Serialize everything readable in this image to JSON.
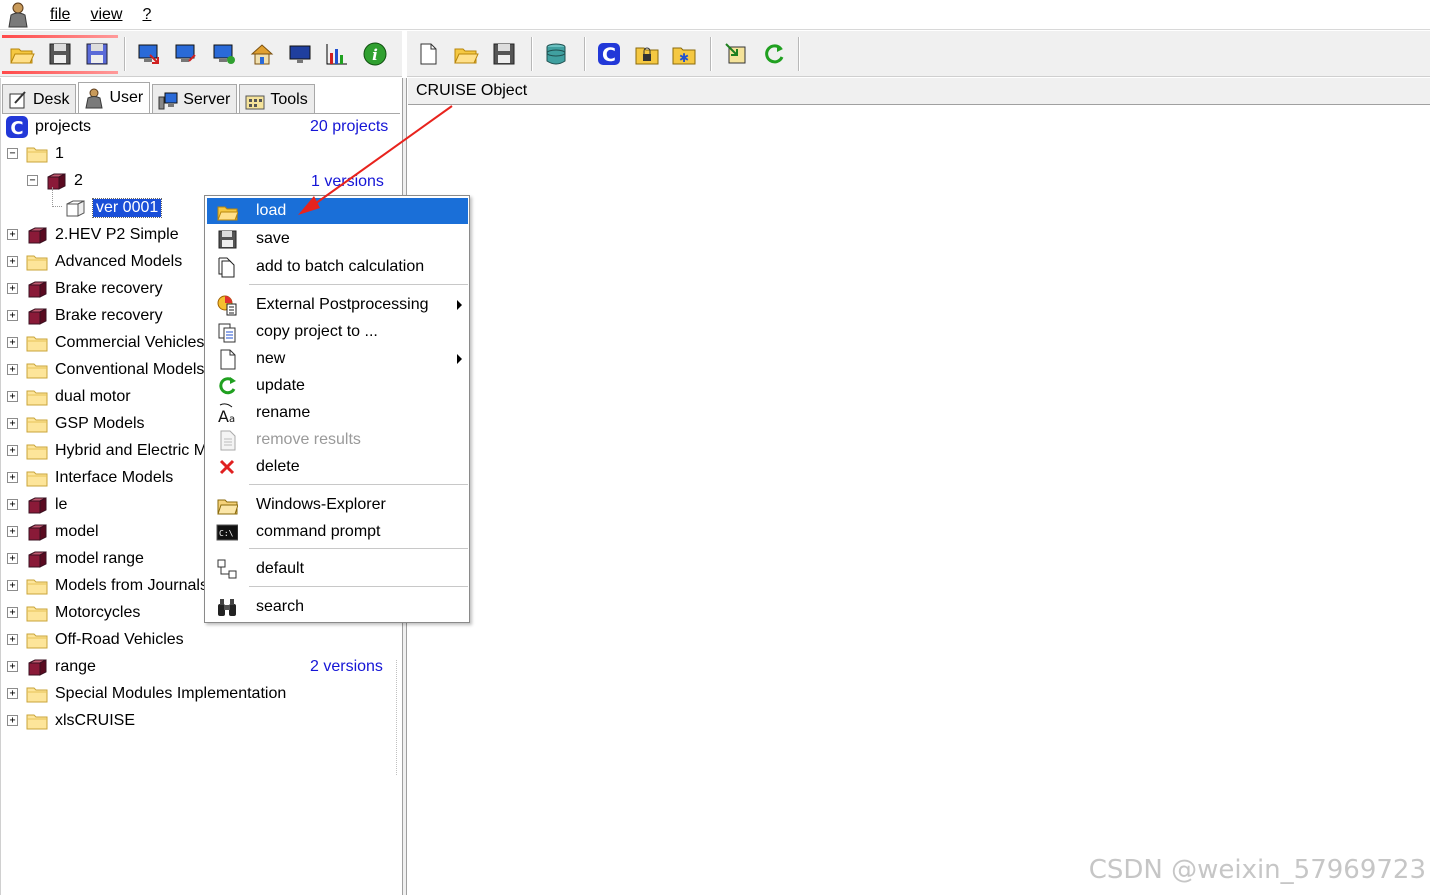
{
  "menubar": {
    "items": [
      "file",
      "view",
      "?"
    ]
  },
  "tabs": [
    {
      "label": "Desk",
      "icon": "desk-icon",
      "active": false
    },
    {
      "label": "User",
      "icon": "user-icon",
      "active": true
    },
    {
      "label": "Server",
      "icon": "server-icon",
      "active": false
    },
    {
      "label": "Tools",
      "icon": "tools-icon",
      "active": false
    }
  ],
  "tree": {
    "root_label": "projects",
    "root_count": "20 projects",
    "folder_1": "1",
    "item_2": "2",
    "item_2_versions": "1 versions",
    "version_label": "ver 0001",
    "items": [
      {
        "label": "2.HEV P2 Simple",
        "type": "model"
      },
      {
        "label": "Advanced Models",
        "type": "folder"
      },
      {
        "label": "Brake recovery",
        "type": "model"
      },
      {
        "label": "Brake recovery",
        "type": "model"
      },
      {
        "label": "Commercial Vehicles",
        "type": "folder"
      },
      {
        "label": "Conventional Models",
        "type": "folder"
      },
      {
        "label": "dual motor",
        "type": "folder"
      },
      {
        "label": "GSP Models",
        "type": "folder"
      },
      {
        "label": "Hybrid and Electric M",
        "type": "folder"
      },
      {
        "label": "Interface Models",
        "type": "folder"
      },
      {
        "label": "le",
        "type": "model"
      },
      {
        "label": "model",
        "type": "model"
      },
      {
        "label": "model range",
        "type": "model"
      },
      {
        "label": "Models from Journals",
        "type": "folder"
      },
      {
        "label": "Motorcycles",
        "type": "folder"
      },
      {
        "label": "Off-Road Vehicles",
        "type": "folder"
      },
      {
        "label": "range",
        "type": "model"
      },
      {
        "label": "Special Modules Implementation",
        "type": "folder"
      },
      {
        "label": "xlsCRUISE",
        "type": "folder"
      }
    ],
    "range_versions": "2 versions"
  },
  "right_panel": {
    "header": "CRUISE Object"
  },
  "context_menu": {
    "items": [
      {
        "label": "load",
        "icon": "folder-open-icon"
      },
      {
        "label": "save",
        "icon": "floppy-icon"
      },
      {
        "label": "add to batch calculation",
        "icon": "batch-icon"
      },
      {
        "label": "External Postprocessing",
        "icon": "postprocessing-icon"
      },
      {
        "label": "copy project to ...",
        "icon": "copy-icon"
      },
      {
        "label": "new",
        "icon": "new-icon"
      },
      {
        "label": "update",
        "icon": "refresh-icon"
      },
      {
        "label": "rename",
        "icon": "rename-icon"
      },
      {
        "label": "remove results",
        "icon": "remove-results-icon"
      },
      {
        "label": "delete",
        "icon": "delete-icon"
      },
      {
        "label": "Windows-Explorer",
        "icon": "explorer-icon"
      },
      {
        "label": "command prompt",
        "icon": "cmd-icon"
      },
      {
        "label": "default",
        "icon": "default-icon"
      },
      {
        "label": "search",
        "icon": "binoculars-icon"
      }
    ]
  },
  "watermark": "CSDN @weixin_57969723",
  "colors": {
    "selection": "#1a6fd8",
    "link_blue": "#1515d6",
    "annotation_arrow": "#e8231d"
  }
}
